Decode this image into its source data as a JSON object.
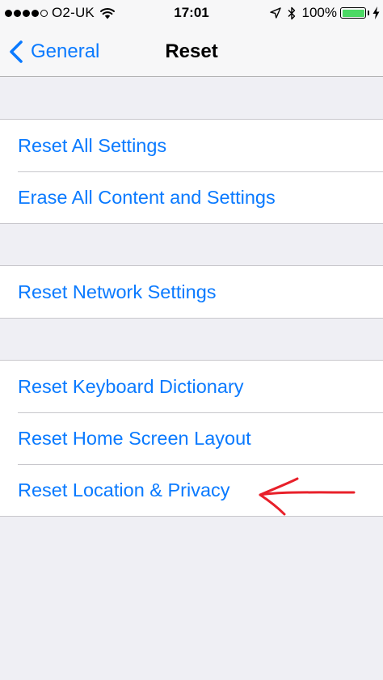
{
  "status_bar": {
    "carrier": "O2-UK",
    "time": "17:01",
    "battery_percent": "100%",
    "signal_bars_filled": 4,
    "signal_bars_total": 5,
    "battery_level": 1.0,
    "battery_color": "#4cd964"
  },
  "nav": {
    "back_label": "General",
    "title": "Reset"
  },
  "groups": [
    {
      "items": [
        "Reset All Settings",
        "Erase All Content and Settings"
      ]
    },
    {
      "items": [
        "Reset Network Settings"
      ]
    },
    {
      "items": [
        "Reset Keyboard Dictionary",
        "Reset Home Screen Layout",
        "Reset Location & Privacy"
      ]
    }
  ],
  "colors": {
    "accent": "#0a7aff",
    "background": "#efeff4",
    "annotation": "#e8202a"
  },
  "icons": [
    "wifi-icon",
    "location-arrow-icon",
    "bluetooth-icon",
    "battery-icon",
    "charging-bolt-icon",
    "chevron-left-icon"
  ]
}
